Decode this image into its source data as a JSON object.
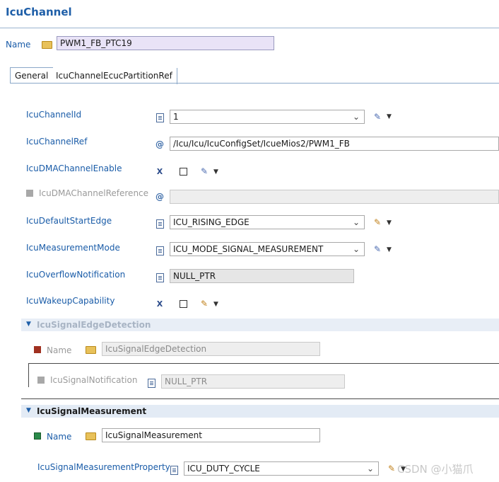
{
  "title": "IcuChannel",
  "name_field": {
    "label": "Name",
    "value": "PWM1_FB_PTC19"
  },
  "tabs": [
    "General",
    "IcuChannelEcucPartitionRef"
  ],
  "params": {
    "icu_channel_id": {
      "label": "IcuChannelId",
      "value": "1"
    },
    "icu_channel_ref": {
      "label": "IcuChannelRef",
      "value": "/Icu/Icu/IcuConfigSet/IcueMios2/PWM1_FB"
    },
    "icu_dma_channel_enable": {
      "label": "IcuDMAChannelEnable",
      "checked": false
    },
    "icu_dma_channel_reference": {
      "label": "IcuDMAChannelReference",
      "value": ""
    },
    "icu_default_start_edge": {
      "label": "IcuDefaultStartEdge",
      "value": "ICU_RISING_EDGE"
    },
    "icu_measurement_mode": {
      "label": "IcuMeasurementMode",
      "value": "ICU_MODE_SIGNAL_MEASUREMENT"
    },
    "icu_overflow_notification": {
      "label": "IcuOverflowNotification",
      "value": "NULL_PTR"
    },
    "icu_wakeup_capability": {
      "label": "IcuWakeupCapability",
      "checked": false
    }
  },
  "signal_edge_detection": {
    "header": "IcuSignalEdgeDetection",
    "name_label": "Name",
    "name_value": "IcuSignalEdgeDetection",
    "notification_label": "IcuSignalNotification",
    "notification_value": "NULL_PTR"
  },
  "signal_measurement": {
    "header": "IcuSignalMeasurement",
    "name_label": "Name",
    "name_value": "IcuSignalMeasurement",
    "property_label": "IcuSignalMeasurementProperty",
    "property_value": "ICU_DUTY_CYCLE"
  },
  "watermark": "CSDN @小猫爪"
}
